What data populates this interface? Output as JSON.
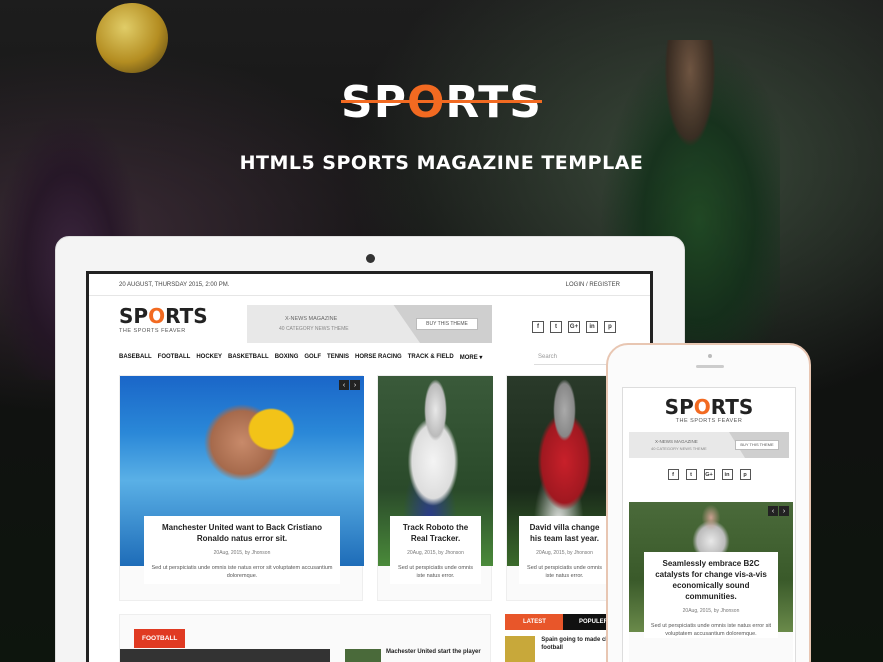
{
  "hero": {
    "logo_prefix": "SP",
    "logo_o": "O",
    "logo_suffix": "RTS",
    "subtitle": "HTML5 SPORTS MAGAZINE TEMPLAE"
  },
  "site": {
    "date": "20 AUGUST, THURSDAY 2015, 2:00 PM.",
    "login": "LOGIN / REGISTER",
    "logo_prefix": "SP",
    "logo_o": "O",
    "logo_suffix": "RTS",
    "tagline": "THE SPORTS FEAVER",
    "ad": {
      "title": "X-NEWS MAGAZINE",
      "sub": "40 CATEGORY NEWS THEME",
      "button": "BUY THIS THEME"
    },
    "social": [
      "f",
      "t",
      "G+",
      "in",
      "p"
    ],
    "nav": [
      "BASEBALL",
      "FOOTBALL",
      "HOCKEY",
      "BASKETBALL",
      "BOXING",
      "GOLF",
      "TENNIS",
      "HORSE RACING",
      "TRACK & FIELD",
      "MORE ▾"
    ],
    "search_placeholder": "Search",
    "cards": [
      {
        "title": "Manchester United want to Back Cristiano Ronaldo natus error sit.",
        "meta": "20Aug, 2015, by Jhonson",
        "excerpt": "Sed ut perspiciatis unde omnis iste natus error sit voluptatem accusantium doloremque."
      },
      {
        "title": "Track Roboto the Real Tracker.",
        "meta": "20Aug, 2015, by Jhonson",
        "excerpt": "Sed ut perspiciatis unde omnis iste natus error."
      },
      {
        "title": "David villa change his team last year.",
        "meta": "20Aug, 2015, by Jhonson",
        "excerpt": "Sed ut perspiciatis unde omnis iste natus error."
      }
    ],
    "category_label": "FOOTBALL",
    "lower_headline": "Machester United start the player",
    "tabs": {
      "latest": "LATEST",
      "popular": "POPULER",
      "item": "Spain going to made class football"
    }
  },
  "phone": {
    "logo_prefix": "SP",
    "logo_o": "O",
    "logo_suffix": "RTS",
    "tagline": "THE SPORTS FEAVER",
    "ad": {
      "title": "X-NEWS MAGAZINE",
      "sub": "40 CATEGORY NEWS THEME",
      "button": "BUY THIS THEME"
    },
    "social": [
      "f",
      "t",
      "G+",
      "in",
      "p"
    ],
    "card": {
      "title": "Seamlessly embrace B2C catalysts for change vis-a-vis economically sound communities.",
      "meta": "20Aug, 2015, by Jhonson",
      "excerpt": "Sed ut perspiciatis unde omnis iste natus error sit voluptatem accusantium doloremque."
    }
  }
}
